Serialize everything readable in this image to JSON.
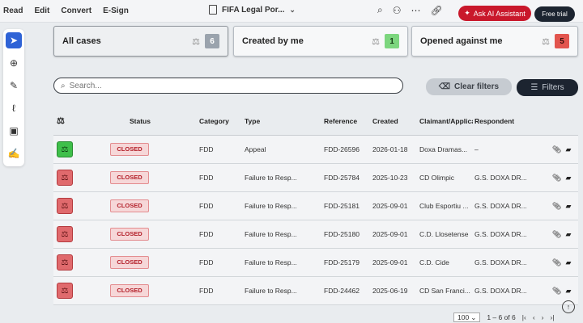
{
  "toolbar": {
    "menu": [
      "Read",
      "Edit",
      "Convert",
      "E-Sign"
    ],
    "doc_title": "FIFA Legal Por...",
    "ai_label": "Ask AI Assistant",
    "trial_label": "Free trial"
  },
  "cards": {
    "all": {
      "label": "All cases",
      "count": "6"
    },
    "created": {
      "label": "Created by me",
      "count": "1"
    },
    "opened": {
      "label": "Opened against me",
      "count": "5"
    }
  },
  "search": {
    "placeholder": "Search..."
  },
  "buttons": {
    "clear_filters": "Clear filters",
    "filters": "Filters"
  },
  "table": {
    "headers": {
      "status": "Status",
      "category": "Category",
      "type": "Type",
      "reference": "Reference",
      "created": "Created",
      "claimant": "Claimant/Applica",
      "respondent": "Respondent"
    },
    "rows": [
      {
        "status": "CLOSED",
        "category": "FDD",
        "type": "Appeal",
        "reference": "FDD-26596",
        "created": "2026-01-18",
        "claimant": "Doxa Dramas...",
        "respondent": "–"
      },
      {
        "status": "CLOSED",
        "category": "FDD",
        "type": "Failure to Resp...",
        "reference": "FDD-25784",
        "created": "2025-10-23",
        "claimant": "CD Olimpic",
        "respondent": "G.S. DOXA DR..."
      },
      {
        "status": "CLOSED",
        "category": "FDD",
        "type": "Failure to Resp...",
        "reference": "FDD-25181",
        "created": "2025-09-01",
        "claimant": "Club Esportiu ...",
        "respondent": "G.S. DOXA DR..."
      },
      {
        "status": "CLOSED",
        "category": "FDD",
        "type": "Failure to Resp...",
        "reference": "FDD-25180",
        "created": "2025-09-01",
        "claimant": "C.D. Llosetense",
        "respondent": "G.S. DOXA DR..."
      },
      {
        "status": "CLOSED",
        "category": "FDD",
        "type": "Failure to Resp...",
        "reference": "FDD-25179",
        "created": "2025-09-01",
        "claimant": "C.D. Cide",
        "respondent": "G.S. DOXA DR..."
      },
      {
        "status": "CLOSED",
        "category": "FDD",
        "type": "Failure to Resp...",
        "reference": "FDD-24462",
        "created": "2025-06-19",
        "claimant": "CD San Franci...",
        "respondent": "G.S. DOXA DR..."
      }
    ]
  },
  "pagination": {
    "per_page": "100",
    "range": "1 – 6 of 6"
  },
  "colors": {
    "accent_red": "#c9182b",
    "dark": "#1c2430",
    "badge_green": "#3fbf4a",
    "badge_red": "#e06a6d"
  }
}
